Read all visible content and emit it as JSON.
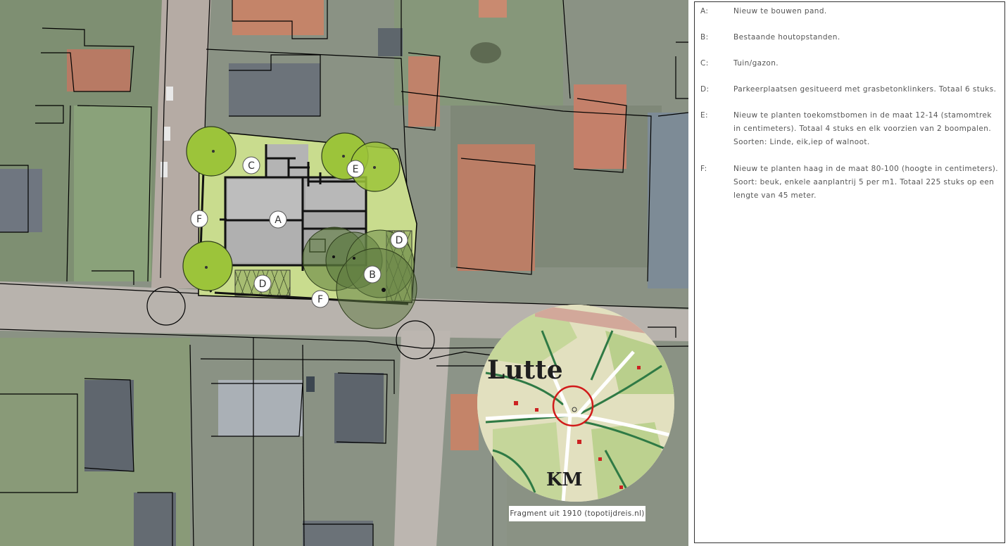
{
  "map": {
    "markers": [
      {
        "letter": "A"
      },
      {
        "letter": "C"
      },
      {
        "letter": "E"
      },
      {
        "letter": "F"
      },
      {
        "letter": "D"
      },
      {
        "letter": "B"
      },
      {
        "letter": "D"
      },
      {
        "letter": "F"
      }
    ],
    "inset": {
      "place_label": "Lutte",
      "map_label": "KM",
      "caption": "Fragment uit 1910 (topotijdreis.nl)"
    },
    "colors": {
      "lawn": "#c8dc8c",
      "new_tree": "#9cc43a",
      "existing_tree": "#5a7a38",
      "building": "#a8a8a8",
      "parking": "#9bb36a",
      "highlight_circle": "#d11a1a"
    }
  },
  "legend": {
    "items": [
      {
        "key": "A:",
        "text": "Nieuw te bouwen pand."
      },
      {
        "key": "B:",
        "text": "Bestaande houtopstanden."
      },
      {
        "key": "C:",
        "text": "Tuin/gazon."
      },
      {
        "key": "D:",
        "text": "Parkeerplaatsen gesitueerd met grasbetonklinkers. Totaal 6 stuks."
      },
      {
        "key": "E:",
        "text": "Nieuw te planten toekomstbomen in de maat 12-14 (stamomtrek in centimeters). Totaal 4 stuks en elk voorzien van 2 boompalen. Soorten: Linde, eik,iep of walnoot."
      },
      {
        "key": "F:",
        "text": "Nieuw te planten haag in de maat 80-100 (hoogte in centimeters). Soort: beuk, enkele aanplantrij 5 per m1. Totaal 225 stuks op een lengte van 45 meter."
      }
    ]
  }
}
